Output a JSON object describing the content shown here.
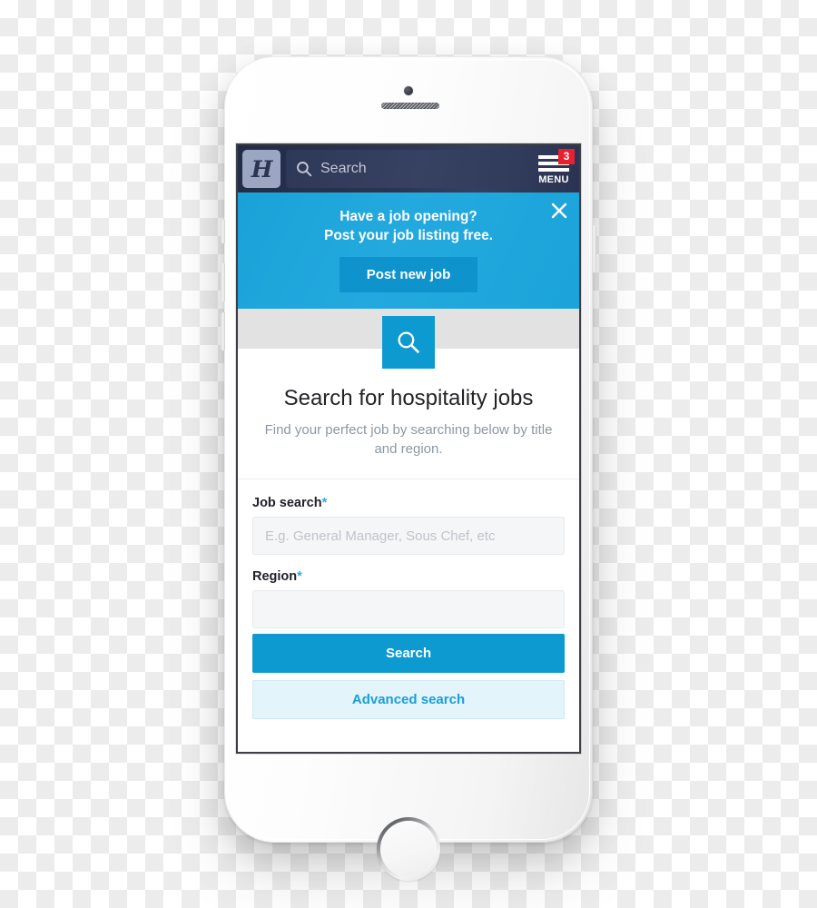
{
  "header": {
    "logo_letter": "H",
    "logo_icon": "script-h-logo",
    "search_placeholder": "Search",
    "search_icon": "search-icon",
    "menu_label": "MENU",
    "menu_badge_count": "3",
    "menu_icon": "hamburger-menu-icon"
  },
  "promo": {
    "line1": "Have a job opening?",
    "line2": "Post your job listing free.",
    "button_label": "Post new job",
    "close_icon": "close-icon"
  },
  "hero": {
    "icon": "search-icon",
    "title": "Search for hospitality jobs",
    "subtitle": "Find your perfect job by searching below by title and region."
  },
  "form": {
    "job_search": {
      "label": "Job search",
      "required_marker": "*",
      "placeholder": "E.g. General Manager, Sous Chef, etc",
      "value": ""
    },
    "region": {
      "label": "Region",
      "required_marker": "*",
      "placeholder": "",
      "value": ""
    },
    "search_button": "Search",
    "advanced_button": "Advanced search"
  },
  "colors": {
    "header_navy": "#2b3553",
    "accent_blue": "#0d9ad1",
    "banner_blue": "#1ba4da",
    "badge_red": "#e8212f",
    "secondary_blue_bg": "#e3f4fb"
  }
}
